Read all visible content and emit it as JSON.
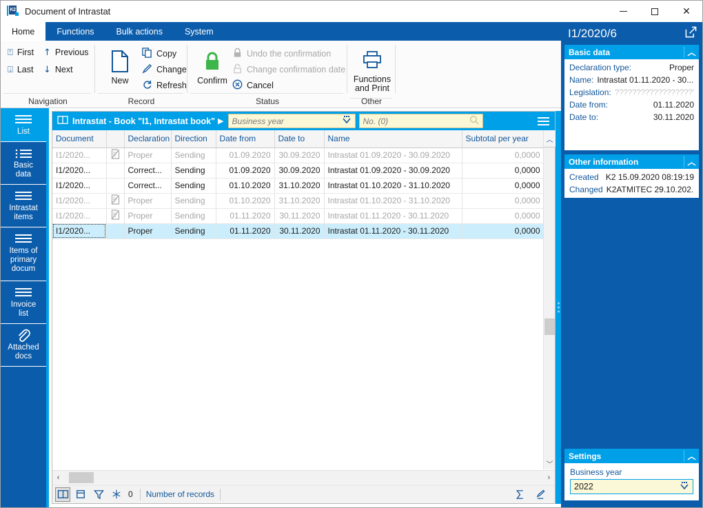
{
  "window": {
    "title": "Document of Intrastat",
    "app_icon": "k2-logo-icon",
    "minimize": "minimize-icon",
    "maximize": "maximize-icon",
    "close": "close-icon"
  },
  "ribbon": {
    "tabs": [
      {
        "label": "Home",
        "active": true
      },
      {
        "label": "Functions",
        "active": false
      },
      {
        "label": "Bulk actions",
        "active": false
      },
      {
        "label": "System",
        "active": false
      }
    ],
    "groups": {
      "navigation": {
        "label": "Navigation",
        "first": "First",
        "previous": "Previous",
        "last": "Last",
        "next": "Next"
      },
      "record": {
        "label": "Record",
        "new": "New",
        "copy": "Copy",
        "change": "Change",
        "refresh": "Refresh"
      },
      "status": {
        "label": "Status",
        "confirm": "Confirm",
        "undo": "Undo the confirmation",
        "change_date": "Change confirmation date",
        "cancel": "Cancel"
      },
      "other": {
        "label": "Other",
        "functions_and_print": "Functions\nand Print",
        "functions_and_print_line1": "Functions",
        "functions_and_print_line2": "and Print"
      }
    },
    "collapse": "collapse-ribbon-icon"
  },
  "sidebar": {
    "items": [
      {
        "label": "List",
        "icon": "list-icon",
        "active": true
      },
      {
        "label": "Basic\ndata",
        "line1": "Basic",
        "line2": "data",
        "icon": "basic-data-icon",
        "active": false
      },
      {
        "label": "Intrastat\nitems",
        "line1": "Intrastat",
        "line2": "items",
        "icon": "list-icon",
        "active": false
      },
      {
        "label": "Items of primary docum",
        "line1": "Items of",
        "line2": "primary",
        "line3": "docum",
        "icon": "list-icon",
        "active": false
      },
      {
        "label": "Invoice\nlist",
        "line1": "Invoice",
        "line2": "list",
        "icon": "list-icon",
        "active": false
      },
      {
        "label": "Attached\ndocs",
        "line1": "Attached",
        "line2": "docs",
        "icon": "paperclip-icon",
        "active": false
      }
    ]
  },
  "grid": {
    "header": {
      "icon": "book-icon",
      "title": "Intrastat - Book \"I1, Intrastat book\"",
      "caret": "filter-caret-icon",
      "business_year_placeholder": "Business year",
      "business_year_value": "",
      "no_placeholder": "No. (0)",
      "no_value": "",
      "search_icon": "search-icon",
      "menu_icon": "hamburger-menu-icon"
    },
    "columns": [
      {
        "label": "Document",
        "align": "left"
      },
      {
        "label": "",
        "align": "center"
      },
      {
        "label": "Declaration",
        "align": "left"
      },
      {
        "label": "Direction",
        "align": "left"
      },
      {
        "label": "Date from",
        "align": "right"
      },
      {
        "label": "Date to",
        "align": "right"
      },
      {
        "label": "Name",
        "align": "left"
      },
      {
        "label": "Subtotal per year",
        "align": "right"
      }
    ],
    "sort_indicator": "sort-asc-icon",
    "rows": [
      {
        "document": "I1/2020...",
        "flag": "document-icon",
        "declaration": "Proper",
        "direction": "Sending",
        "date_from": "01.09.2020",
        "date_to": "30.09.2020",
        "name": "Intrastat 01.09.2020 - 30.09.2020",
        "subtotal": "0,0000",
        "dim": true,
        "selected": false
      },
      {
        "document": "I1/2020...",
        "flag": "",
        "declaration": "Correct...",
        "direction": "Sending",
        "date_from": "01.09.2020",
        "date_to": "30.09.2020",
        "name": "Intrastat 01.09.2020 - 30.09.2020",
        "subtotal": "0,0000",
        "dim": false,
        "selected": false
      },
      {
        "document": "I1/2020...",
        "flag": "",
        "declaration": "Correct...",
        "direction": "Sending",
        "date_from": "01.10.2020",
        "date_to": "31.10.2020",
        "name": "Intrastat 01.10.2020 - 31.10.2020",
        "subtotal": "0,0000",
        "dim": false,
        "selected": false
      },
      {
        "document": "I1/2020...",
        "flag": "document-icon",
        "declaration": "Proper",
        "direction": "Sending",
        "date_from": "01.10.2020",
        "date_to": "31.10.2020",
        "name": "Intrastat 01.10.2020 - 31.10.2020",
        "subtotal": "0,0000",
        "dim": true,
        "selected": false
      },
      {
        "document": "I1/2020...",
        "flag": "document-icon",
        "declaration": "Proper",
        "direction": "Sending",
        "date_from": "01.11.2020",
        "date_to": "30.11.2020",
        "name": "Intrastat 01.11.2020 - 30.11.2020",
        "subtotal": "0,0000",
        "dim": true,
        "selected": false
      },
      {
        "document": "I1/2020...",
        "flag": "",
        "declaration": "Proper",
        "direction": "Sending",
        "date_from": "01.11.2020",
        "date_to": "30.11.2020",
        "name": "Intrastat 01.11.2020 - 30.11.2020",
        "subtotal": "0,0000",
        "dim": false,
        "selected": true
      }
    ],
    "statusbar": {
      "book_view": "book-view-icon",
      "card_view": "card-view-icon",
      "filter": "filter-icon",
      "snowflake": "snowflake-icon",
      "count": "0",
      "records_label": "Number of records",
      "sum_icon": "sigma-icon",
      "edit_icon": "pencil-edit-icon"
    }
  },
  "detail": {
    "title": "I1/2020/6",
    "expand_icon": "open-in-new-window-icon",
    "basic_data": {
      "header": "Basic data",
      "collapse_icon": "chevron-up-icon",
      "rows": [
        {
          "label": "Declaration type:",
          "value": "Proper",
          "placeholder": false
        },
        {
          "label": "Name:",
          "value": "Intrastat 01.11.2020 - 30....",
          "placeholder": false,
          "inline": true
        },
        {
          "label": "Legislation:",
          "value": "????????????????????????",
          "placeholder": true
        },
        {
          "label": "Date from:",
          "value": "01.11.2020",
          "placeholder": false
        },
        {
          "label": "Date to:",
          "value": "30.11.2020",
          "placeholder": false
        }
      ]
    },
    "other_information": {
      "header": "Other information",
      "collapse_icon": "chevron-up-icon",
      "rows": [
        {
          "label": "Created",
          "value": "K2 15.09.2020 08:19:19"
        },
        {
          "label": "Changed",
          "value": "K2ATMITEC 29.10.202..."
        }
      ]
    },
    "settings": {
      "header": "Settings",
      "collapse_icon": "chevron-up-icon",
      "business_year_label": "Business year",
      "business_year_value": "2022",
      "dropdown_icon": "dropdown-calendar-icon"
    }
  },
  "colors": {
    "ribbon_blue": "#0b5cab",
    "accent_cyan": "#00a0e8",
    "link_blue": "#10559a",
    "field_yellow": "#fbf8d8",
    "selection_blue": "#cceefc",
    "confirm_green": "#3cb54a"
  }
}
